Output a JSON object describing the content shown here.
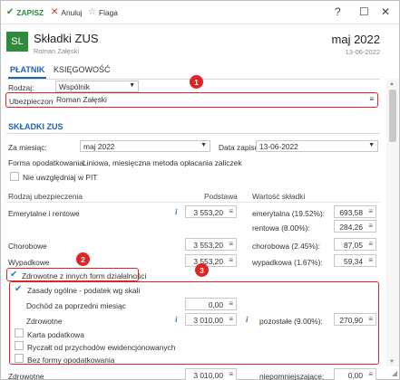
{
  "toolbar": {
    "save": "ZAPISZ",
    "cancel": "Anuluj",
    "flag": "Flaga",
    "help": "?",
    "maximize": "☐",
    "close": "✕"
  },
  "header": {
    "badge": "SL",
    "title": "Składki ZUS",
    "subtitle": "Roman Załęski",
    "month": "maj 2022",
    "date": "13-06-2022"
  },
  "tabs": [
    "PŁATNIK",
    "KSIĘGOWOŚĆ"
  ],
  "payer": {
    "type_label": "Rodzaj:",
    "type_value": "Wspólnik",
    "insured_label": "Ubezpieczony:",
    "insured_value": "Roman Załęski"
  },
  "zus": {
    "section_title": "SKŁADKI ZUS",
    "month_label": "Za miesiąc:",
    "month_value": "maj 2022",
    "record_label": "Data zapisu:",
    "record_value": "13-06-2022",
    "tax_form_label": "Forma opodatkowania:",
    "tax_form_value": "Liniowa, miesięczna metoda opłacania zaliczek",
    "exclude_pit_label": "Nie uwzględniaj w PIT",
    "col_type": "Rodzaj ubezpieczenia",
    "col_base": "Podstawa",
    "col_value": "Wartość składki",
    "rows": {
      "pension_label": "Emerytalne i rentowe",
      "pension_base": "3 553,20",
      "emerytalna_label": "emerytalna (19.52%):",
      "emerytalna_value": "693,58",
      "rentowa_label": "rentowa (8.00%):",
      "rentowa_value": "284,26",
      "sickness_label": "Chorobowe",
      "sickness_base": "3 553,20",
      "chorobowa_label": "chorobowa (2.45%):",
      "chorobowa_value": "87,05",
      "accident_label": "Wypadkowe",
      "accident_base": "3 553,20",
      "wypadkowa_label": "wypadkowa (1.67%):",
      "wypadkowa_value": "59,34"
    },
    "health_check_label": "Zdrowotne z innych form działalności",
    "health": {
      "general_label": "Zasady ogólne - podatek wg skali",
      "prev_income_label": "Dochód za poprzedni miesiąc",
      "prev_income_value": "0,00",
      "health_label": "Zdrowotne",
      "health_base": "3 010,00",
      "other_label": "pozostałe (9.00%):",
      "other_value": "270,90",
      "card_label": "Karta podatkowa",
      "lump_label": "Ryczałt od przychodów ewidencjonowanych",
      "none_label": "Bez formy opodatkowania"
    },
    "bottom_label": "Zdrowotne",
    "bottom_base": "3 010,00",
    "bottom_value_label": "niepomniejszające:",
    "bottom_value": "0,00"
  },
  "annotations": [
    "1",
    "2",
    "3"
  ],
  "colors": {
    "accent": "#1f62b4",
    "highlight": "#e02424",
    "badge": "#2e8b3e",
    "info": "#2a7bd3"
  }
}
